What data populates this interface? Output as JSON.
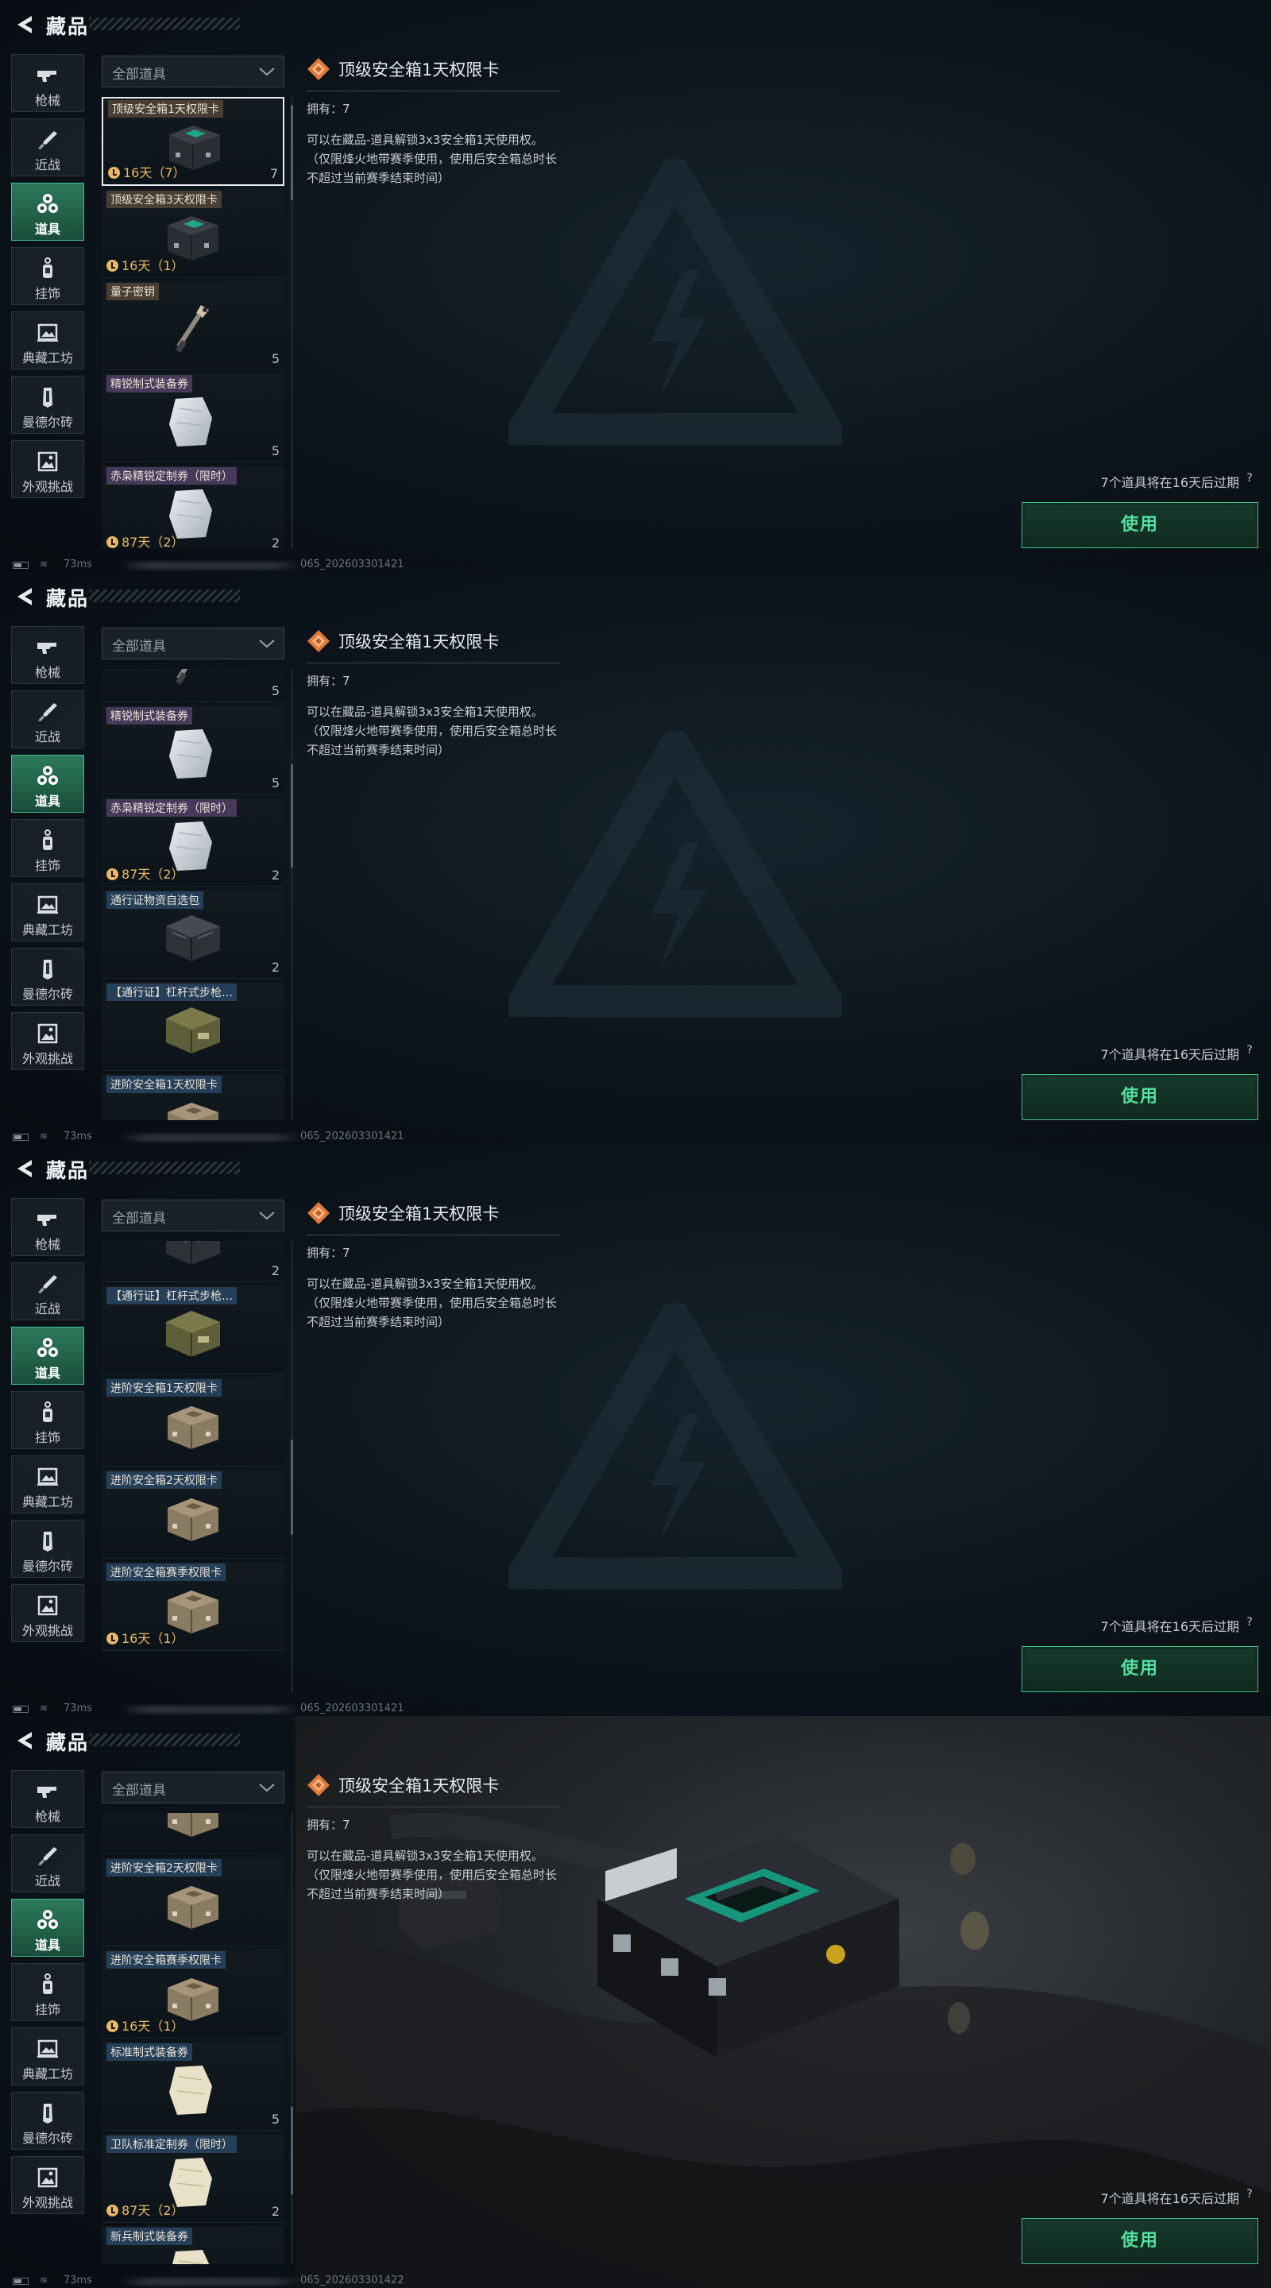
{
  "header": {
    "title": "藏品"
  },
  "sidebar": {
    "items": [
      {
        "label": "枪械",
        "icon": "gun-icon"
      },
      {
        "label": "近战",
        "icon": "knife-icon"
      },
      {
        "label": "道具",
        "icon": "items-icon",
        "active": true
      },
      {
        "label": "挂饰",
        "icon": "charm-icon"
      },
      {
        "label": "典藏工坊",
        "icon": "workshop-icon"
      },
      {
        "label": "曼德尔砖",
        "icon": "brick-icon"
      },
      {
        "label": "外观挑战",
        "icon": "challenge-icon"
      }
    ]
  },
  "filter": {
    "label": "全部道具"
  },
  "detail": {
    "name": "顶级安全箱1天权限卡",
    "owned": "拥有：7",
    "description": "可以在藏品-道具解锁3x3安全箱1天使用权。（仅限烽火地带赛季使用，使用后安全箱总时长不超过当前赛季结束时间）",
    "expire_note": "7个道具将在16天后过期",
    "help": "?",
    "use_button": "使用"
  },
  "status": {
    "ping": "73ms",
    "session_ids": [
      "065_202603301421",
      "065_202603301421",
      "065_202603301421",
      "065_202603301422"
    ]
  },
  "frames": [
    {
      "items": [
        {
          "name": "顶级安全箱1天权限卡",
          "timer": "16天（7）",
          "count": "7",
          "tag": "brown",
          "pic": "blackcase",
          "selected": true
        },
        {
          "name": "顶级安全箱3天权限卡",
          "timer": "16天（1）",
          "count": "",
          "tag": "brown",
          "pic": "blackcase"
        },
        {
          "name": "量子密钥",
          "timer": "",
          "count": "5",
          "tag": "brown",
          "pic": "key"
        },
        {
          "name": "精锐制式装备券",
          "timer": "",
          "count": "5",
          "tag": "purple",
          "pic": "bag"
        },
        {
          "name": "赤枭精锐定制券（限时）",
          "timer": "87天（2）",
          "count": "2",
          "tag": "purple",
          "pic": "bag"
        }
      ]
    },
    {
      "items": [
        {
          "name": "",
          "timer": "",
          "count": "5",
          "tag": "none",
          "pic": "key"
        },
        {
          "name": "精锐制式装备券",
          "timer": "",
          "count": "5",
          "tag": "purple",
          "pic": "bag"
        },
        {
          "name": "赤枭精锐定制券（限时）",
          "timer": "87天（2）",
          "count": "2",
          "tag": "purple",
          "pic": "bag"
        },
        {
          "name": "通行证物资自选包",
          "timer": "",
          "count": "2",
          "tag": "blue",
          "pic": "crate"
        },
        {
          "name": "【通行证】杠杆式步枪…",
          "timer": "",
          "count": "",
          "tag": "blue",
          "pic": "greencrate"
        },
        {
          "name": "进阶安全箱1天权限卡",
          "timer": "",
          "count": "",
          "tag": "blue",
          "pic": "tancase"
        }
      ]
    },
    {
      "items": [
        {
          "name": "",
          "timer": "",
          "count": "2",
          "tag": "none",
          "pic": "crate"
        },
        {
          "name": "【通行证】杠杆式步枪…",
          "timer": "",
          "count": "",
          "tag": "blue",
          "pic": "greencrate"
        },
        {
          "name": "进阶安全箱1天权限卡",
          "timer": "",
          "count": "",
          "tag": "blue",
          "pic": "tancase"
        },
        {
          "name": "进阶安全箱2天权限卡",
          "timer": "",
          "count": "",
          "tag": "blue",
          "pic": "tancase"
        },
        {
          "name": "进阶安全箱赛季权限卡",
          "timer": "16天（1）",
          "count": "",
          "tag": "blue",
          "pic": "tancase"
        }
      ]
    },
    {
      "items": [
        {
          "name": "",
          "timer": "",
          "count": "",
          "tag": "none",
          "pic": "tancase"
        },
        {
          "name": "进阶安全箱2天权限卡",
          "timer": "",
          "count": "",
          "tag": "blue",
          "pic": "tancase"
        },
        {
          "name": "进阶安全箱赛季权限卡",
          "timer": "16天（1）",
          "count": "",
          "tag": "blue",
          "pic": "tancase"
        },
        {
          "name": "标准制式装备券",
          "timer": "",
          "count": "5",
          "tag": "blue",
          "pic": "paper"
        },
        {
          "name": "卫队标准定制券（限时）",
          "timer": "87天（2）",
          "count": "2",
          "tag": "blue",
          "pic": "paper"
        },
        {
          "name": "新兵制式装备券",
          "timer": "",
          "count": "",
          "tag": "blue",
          "pic": "paper"
        }
      ]
    }
  ],
  "list_scroll": [
    0,
    0.62,
    1.2,
    1.7
  ],
  "colors": {
    "accent": "#3fbf86",
    "timer": "#e8b865",
    "use_text": "#54e0a0"
  }
}
